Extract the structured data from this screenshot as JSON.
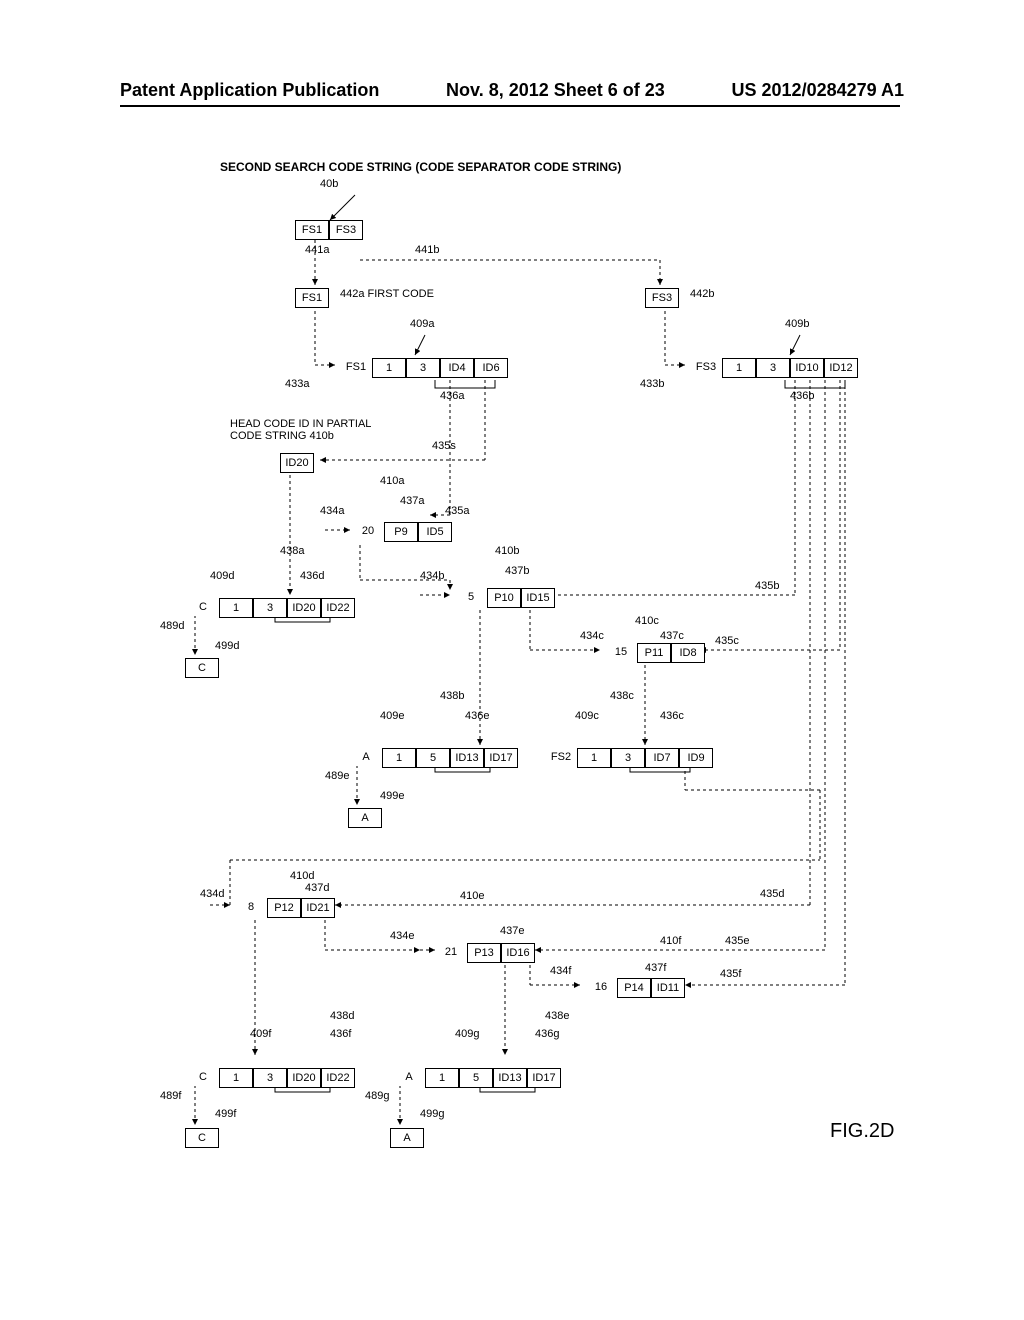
{
  "header": {
    "left": "Patent Application Publication",
    "center": "Nov. 8, 2012   Sheet 6 of 23",
    "right": "US 2012/0284279 A1"
  },
  "title": "SECOND SEARCH CODE STRING (CODE SEPARATOR CODE STRING)",
  "labels": {
    "r40b": "40b",
    "r441a": "441a",
    "r441b": "441b",
    "r442a": "442a FIRST CODE",
    "r442b": "442b",
    "r409a": "409a",
    "r409b": "409b",
    "r433a": "433a",
    "r433b": "433b",
    "r436a": "436a",
    "r436b": "436b",
    "head_code": "HEAD CODE ID IN PARTIAL CODE STRING 410b",
    "r435s": "435s",
    "r410a": "410a",
    "r437a": "437a",
    "r434a": "434a",
    "r435a": "435a",
    "r438a": "438a",
    "r409d": "409d",
    "r436d": "436d",
    "r410b": "410b",
    "r434b": "434b",
    "r437b": "437b",
    "r435b": "435b",
    "r489d": "489d",
    "r499d": "499d",
    "r410c": "410c",
    "r434c": "434c",
    "r437c": "437c",
    "r435c": "435c",
    "r438b": "438b",
    "r438c": "438c",
    "r409e": "409e",
    "r436e": "436e",
    "r409c": "409c",
    "r436c": "436c",
    "r489e": "489e",
    "r499e": "499e",
    "r410d": "410d",
    "r434d": "434d",
    "r437d": "437d",
    "r410e": "410e",
    "r435d": "435d",
    "r434e": "434e",
    "r437e": "437e",
    "r410f": "410f",
    "r435e": "435e",
    "r434f": "434f",
    "r437f": "437f",
    "r435f": "435f",
    "r438d": "438d",
    "r438e": "438e",
    "r409f": "409f",
    "r436f": "436f",
    "r409g": "409g",
    "r436g": "436g",
    "r489f": "489f",
    "r499f": "499f",
    "r489g": "489g",
    "r499g": "499g"
  },
  "cells": {
    "row40b": [
      "FS1",
      "FS3"
    ],
    "row442a": [
      "FS1"
    ],
    "row442b": [
      "FS3"
    ],
    "row409a": [
      "FS1",
      "1",
      "3",
      "ID4",
      "ID6"
    ],
    "row409b": [
      "FS3",
      "1",
      "3",
      "ID10",
      "ID12"
    ],
    "rowID20": [
      "ID20"
    ],
    "row410a": [
      "20",
      "P9",
      "ID5"
    ],
    "row410b": [
      "5",
      "P10",
      "ID15"
    ],
    "row409d": [
      "C",
      "1",
      "3",
      "ID20",
      "ID22"
    ],
    "row499d": [
      "C"
    ],
    "row410c": [
      "15",
      "P11",
      "ID8"
    ],
    "row409e": [
      "A",
      "1",
      "5",
      "ID13",
      "ID17"
    ],
    "row409c": [
      "FS2",
      "1",
      "3",
      "ID7",
      "ID9"
    ],
    "row499e": [
      "A"
    ],
    "row410d": [
      "8",
      "P12",
      "ID21"
    ],
    "row410e": [
      "21",
      "P13",
      "ID16"
    ],
    "row410f": [
      "16",
      "P14",
      "ID11"
    ],
    "row409f": [
      "C",
      "1",
      "3",
      "ID20",
      "ID22"
    ],
    "row409g": [
      "A",
      "1",
      "5",
      "ID13",
      "ID17"
    ],
    "row499f": [
      "C"
    ],
    "row499g": [
      "A"
    ]
  },
  "figure_label": "FIG.2D"
}
